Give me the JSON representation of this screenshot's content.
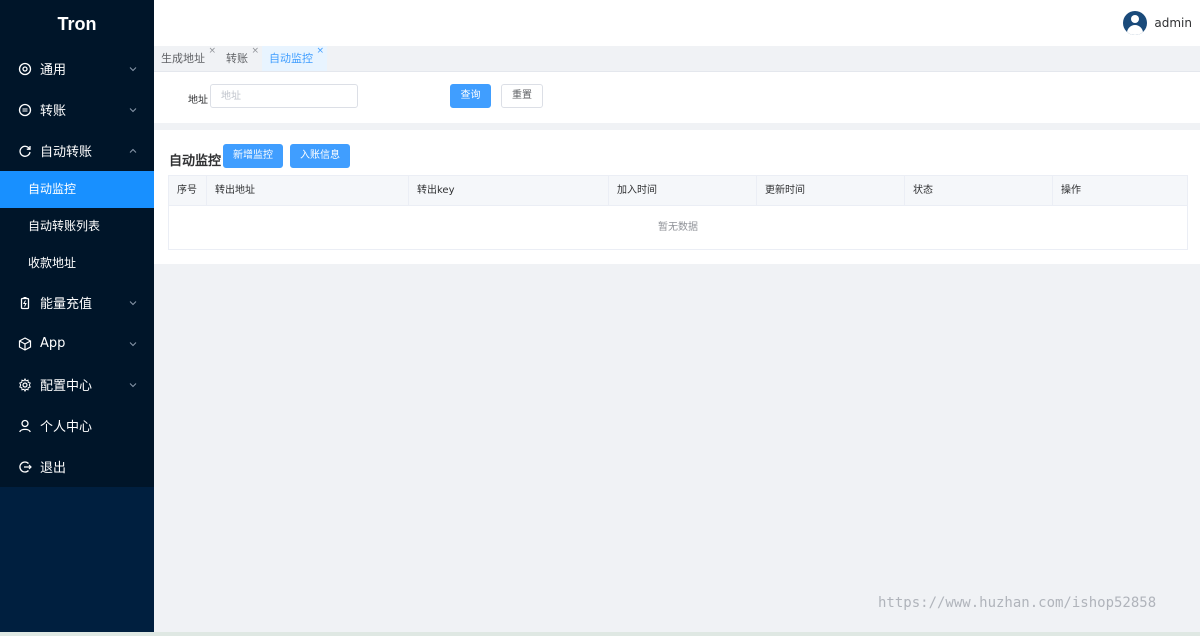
{
  "app": {
    "logo": "Tron"
  },
  "sidebar": {
    "items": [
      {
        "label": "通用",
        "icon": "target-icon",
        "expanded": false
      },
      {
        "label": "转账",
        "icon": "transfer-icon",
        "expanded": false
      },
      {
        "label": "自动转账",
        "icon": "refresh-icon",
        "expanded": true,
        "children": [
          {
            "label": "自动监控",
            "active": true
          },
          {
            "label": "自动转账列表",
            "active": false
          },
          {
            "label": "收款地址",
            "active": false
          }
        ]
      },
      {
        "label": "能量充值",
        "icon": "battery-icon",
        "expanded": false
      },
      {
        "label": "App",
        "icon": "cube-icon",
        "expanded": false
      },
      {
        "label": "配置中心",
        "icon": "gear-icon",
        "expanded": false
      },
      {
        "label": "个人中心",
        "icon": "user-icon"
      },
      {
        "label": "退出",
        "icon": "logout-icon"
      }
    ]
  },
  "header": {
    "username": "admin"
  },
  "tabs": [
    {
      "label": "生成地址",
      "active": false
    },
    {
      "label": "转账",
      "active": false
    },
    {
      "label": "自动监控",
      "active": true
    }
  ],
  "tab_close_glyph": "×",
  "search": {
    "label": "地址",
    "placeholder": "地址",
    "value": "",
    "query_button": "查询",
    "reset_button": "重置"
  },
  "main": {
    "title": "自动监控",
    "add_button": "新增监控",
    "deposit_button": "入账信息",
    "table": {
      "columns": [
        "序号",
        "转出地址",
        "转出key",
        "加入时间",
        "更新时间",
        "状态",
        "操作"
      ],
      "rows": [],
      "empty_text": "暂无数据"
    }
  },
  "watermark": "https://www.huzhan.com/ishop52858",
  "colors": {
    "sidebar_bg": "#001529",
    "active_item": "#1890ff",
    "primary": "#409eff"
  }
}
